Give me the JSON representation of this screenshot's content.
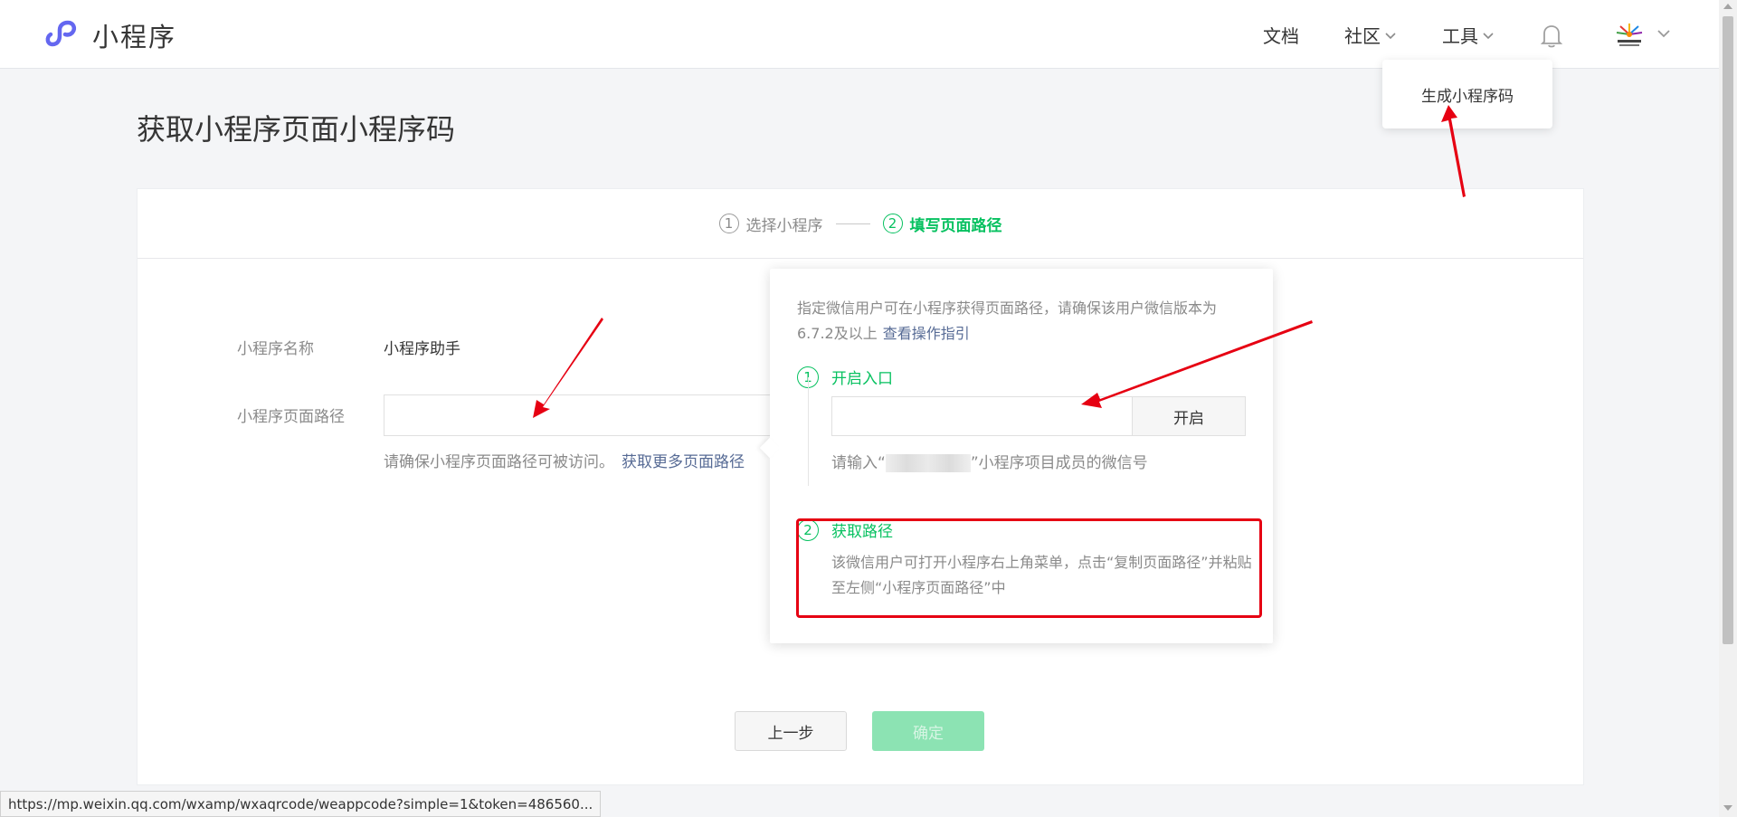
{
  "header": {
    "app_name": "小程序",
    "nav": {
      "docs": "文档",
      "community": "社区",
      "tools": "工具"
    },
    "tools_menu": {
      "generate_qrcode": "生成小程序码"
    }
  },
  "page": {
    "title": "获取小程序页面小程序码",
    "steps": [
      {
        "num": "1",
        "label": "选择小程序"
      },
      {
        "num": "2",
        "label": "填写页面路径"
      }
    ],
    "form": {
      "name_label": "小程序名称",
      "name_value": "小程序助手",
      "path_label": "小程序页面路径",
      "path_value": "",
      "hint": "请确保小程序页面路径可被访问。",
      "more_paths_link": "获取更多页面路径"
    },
    "buttons": {
      "prev": "上一步",
      "confirm": "确定"
    }
  },
  "popover": {
    "desc": "指定微信用户可在小程序获得页面路径，请确保该用户微信版本为6.7.2及以上",
    "guide_link": "查看操作指引",
    "step1": {
      "num": "1",
      "title": "开启入口",
      "input_value": "",
      "button": "开启",
      "hint_prefix": "请输入“",
      "hint_suffix": "”小程序项目成员的微信号"
    },
    "step2": {
      "num": "2",
      "title": "获取路径",
      "desc": "该微信用户可打开小程序右上角菜单，点击“复制页面路径”并粘贴至左侧“小程序页面路径”中"
    }
  },
  "status_bar": {
    "url": "https://mp.weixin.qq.com/wxamp/wxaqrcode/weappcode?simple=1&token=486560..."
  },
  "colors": {
    "accent": "#07c160",
    "link": "#576b95",
    "annotation": "#e60012"
  },
  "icons": [
    "miniprogram-logo-icon",
    "chevron-down-icon",
    "bell-icon",
    "avatar-image"
  ]
}
